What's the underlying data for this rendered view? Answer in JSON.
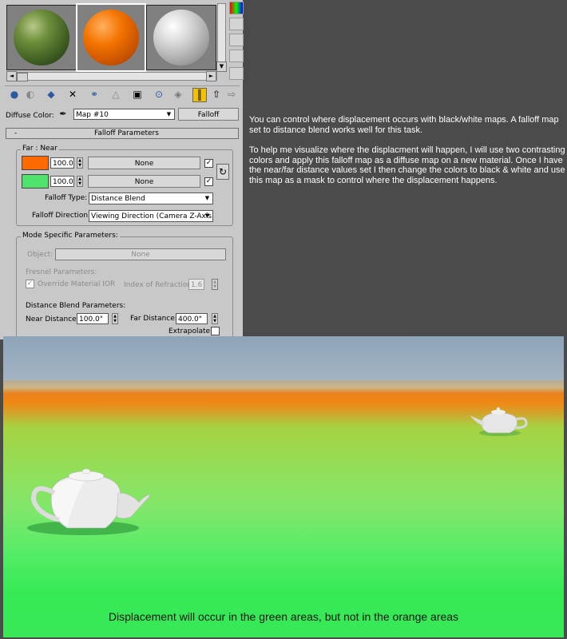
{
  "material_editor": {
    "sample_slots": [
      {
        "name": "grass-sphere",
        "color": "#4e6e2c"
      },
      {
        "name": "orange-sphere",
        "color": "#f06a00",
        "active": true
      },
      {
        "name": "gray-sphere",
        "color": "#c8c8c8"
      }
    ],
    "diffuse_label": "Diffuse Color:",
    "map_name": "Map #10",
    "map_type": "Falloff",
    "rollout_title": "Falloff Parameters",
    "rollout_toggle": "-",
    "far_near_label": "Far : Near",
    "far": {
      "color": "#ff6a00",
      "amount": "100.0",
      "map": "None"
    },
    "near": {
      "color": "#4fe36b",
      "amount": "100.0",
      "map": "None"
    },
    "swap_icon": "swap-arrow-icon",
    "falloff_type_label": "Falloff Type:",
    "falloff_type": "Distance Blend",
    "falloff_direction_label": "Falloff Direction:",
    "falloff_direction": "Viewing Direction (Camera Z-Axis)",
    "mode_specific_label": "Mode Specific Parameters:",
    "object_label": "Object:",
    "object_value": "None",
    "fresnel_label": "Fresnel Parameters:",
    "override_ior_label": "Override Material IOR",
    "ior_label": "Index of Refraction",
    "ior_value": "1.6",
    "distance_blend_label": "Distance Blend Parameters:",
    "near_distance_label": "Near Distance:",
    "near_distance": "100.0\"",
    "far_distance_label": "Far Distance:",
    "far_distance": "400.0\"",
    "extrapolate_label": "Extrapolate"
  },
  "description": {
    "para1": "You can control where displacement occurs with black/white maps.  A falloff map set to distance blend works well for this task.",
    "para2": "To help me visualize where the displacment will happen, I will use two contrasting colors and apply this falloff map as a diffuse map on a new material.  Once I have the near/far distance values set I then change the colors to black & white and use this map as a mask to control where the displacement happens."
  },
  "render": {
    "caption": "Displacement will occur in the green areas, but not in the orange areas"
  }
}
